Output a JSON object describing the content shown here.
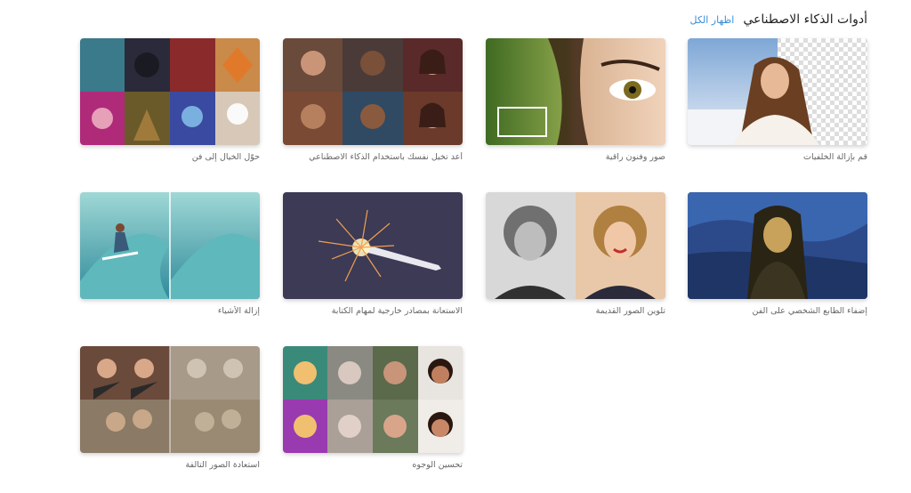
{
  "header": {
    "title": "أدوات الذكاء الاصطناعي",
    "show_all": "اظهار الكل"
  },
  "tools": [
    {
      "label": "قم بإزالة الخلفيات",
      "icon": "background-removal-thumbnail"
    },
    {
      "label": "صور وفنون راقية",
      "icon": "fine-art-photo-thumbnail"
    },
    {
      "label": "أعد تخيل نفسك باستخدام الذكاء الاصطناعي",
      "icon": "ai-portrait-thumbnail"
    },
    {
      "label": "حوّل الخيال إلى فن",
      "icon": "imagination-art-thumbnail"
    },
    {
      "label": "إضفاء الطابع الشخصي على الفن",
      "icon": "personalized-art-thumbnail"
    },
    {
      "label": "تلوين الصور القديمة",
      "icon": "colorize-photo-thumbnail"
    },
    {
      "label": "الاستعانة بمصادر خارجية لمهام الكتابة",
      "icon": "writing-thumbnail"
    },
    {
      "label": "إزالة الأشياء",
      "icon": "object-removal-thumbnail"
    },
    {
      "label": "استعادة الصور التالفة",
      "icon": "photo-restore-thumbnail"
    },
    {
      "label": "تحسين الوجوه",
      "icon": "face-enhance-thumbnail"
    }
  ]
}
